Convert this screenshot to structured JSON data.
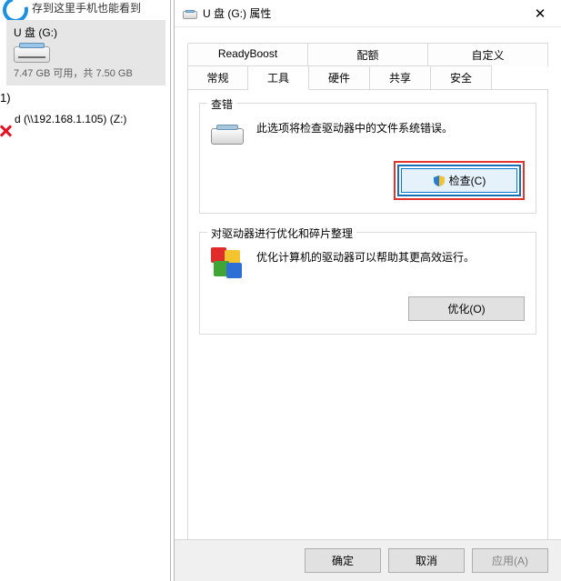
{
  "left": {
    "hint": "存到这里手机也能看到",
    "drive_title": "U 盘 (G:)",
    "drive_sub": "7.47 GB 可用，共 7.50 GB",
    "section_count": "1)",
    "network_drive": "d (\\\\192.168.1.105) (Z:)"
  },
  "title": "U 盘 (G:) 属性",
  "tabs_top": [
    "ReadyBoost",
    "配额",
    "自定义"
  ],
  "tabs_bottom": [
    "常规",
    "工具",
    "硬件",
    "共享",
    "安全"
  ],
  "check_error": {
    "legend": "查错",
    "desc": "此选项将检查驱动器中的文件系统错误。",
    "button": "检查(C)"
  },
  "defrag": {
    "legend": "对驱动器进行优化和碎片整理",
    "desc": "优化计算机的驱动器可以帮助其更高效运行。",
    "button": "优化(O)"
  },
  "footer": {
    "ok": "确定",
    "cancel": "取消",
    "apply": "应用(A)"
  }
}
